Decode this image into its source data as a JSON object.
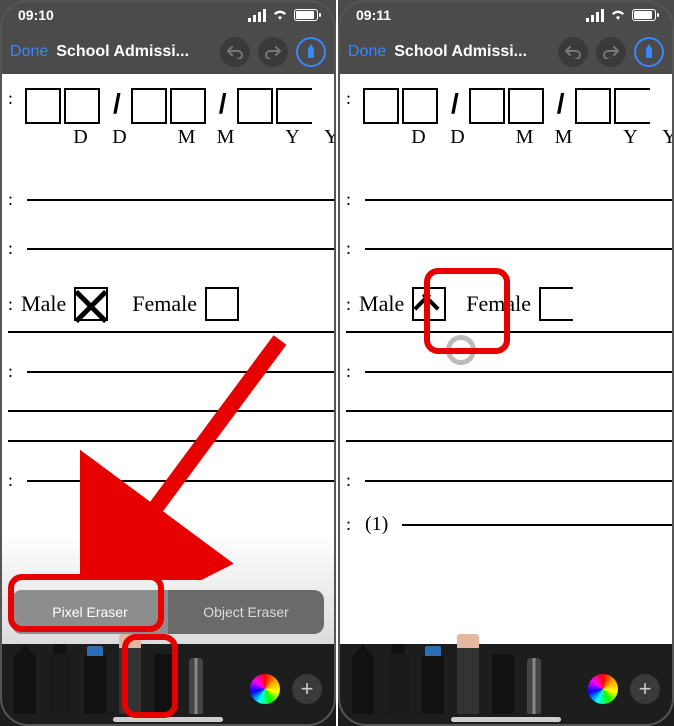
{
  "left": {
    "status": {
      "time": "09:10"
    },
    "nav": {
      "done": "Done",
      "title": "School Admissi..."
    },
    "doc": {
      "date_labels": [
        "D",
        "D",
        "M",
        "M",
        "Y",
        "Y"
      ],
      "gender_male": "Male",
      "gender_female": "Female"
    },
    "eraser_options": {
      "pixel": "Pixel Eraser",
      "object": "Object Eraser"
    }
  },
  "right": {
    "status": {
      "time": "09:11"
    },
    "nav": {
      "done": "Done",
      "title": "School Admissi..."
    },
    "doc": {
      "date_labels": [
        "D",
        "D",
        "M",
        "M",
        "Y",
        "Y"
      ],
      "gender_male": "Male",
      "gender_female": "Female",
      "footnote": "(1)"
    }
  }
}
